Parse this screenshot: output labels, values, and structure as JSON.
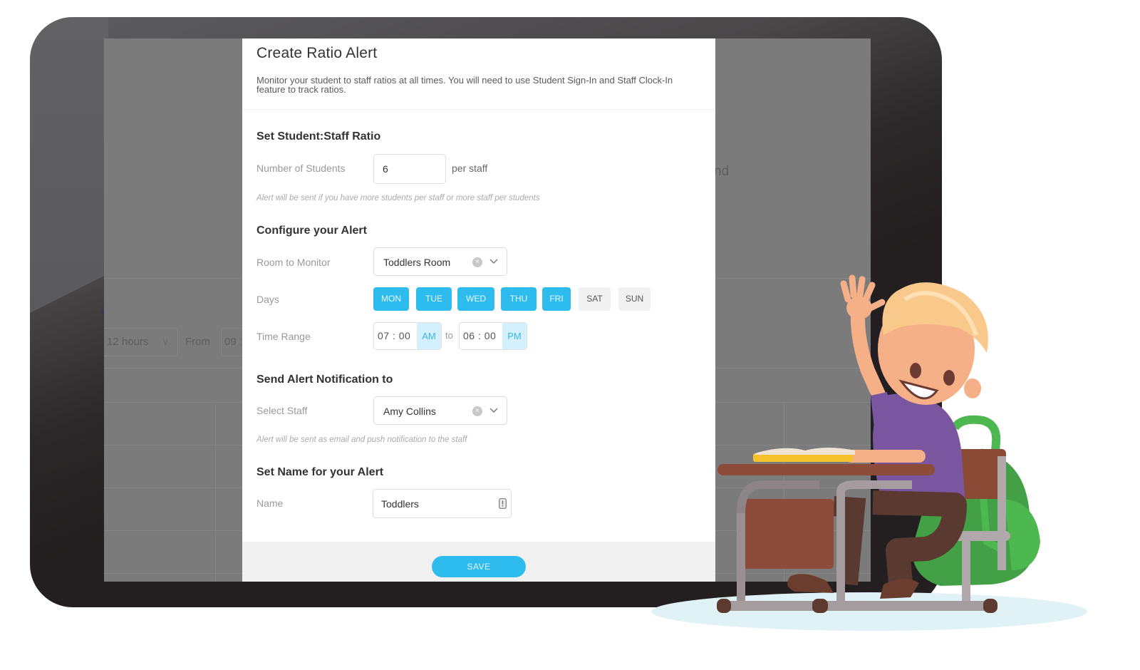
{
  "background_screen": {
    "duration_select": "12 hours",
    "from_label": "From",
    "from_time_partial": "09 :",
    "partial_text": "nd"
  },
  "modal": {
    "title": "Create Ratio Alert",
    "description": "Monitor your student to staff ratios at all times. You will need to use Student Sign-In and Staff Clock-In feature to track ratios.",
    "close_icon": "close-icon",
    "ratio_section": {
      "title": "Set Student:Staff Ratio",
      "students_label": "Number of Students",
      "students_value": "6",
      "suffix": "per staff",
      "hint": "Alert will be sent if you have more students per staff or more staff per students"
    },
    "configure_section": {
      "title": "Configure your Alert",
      "room_label": "Room to Monitor",
      "room_value": "Toddlers Room",
      "days_label": "Days",
      "days": [
        {
          "label": "MON",
          "selected": true
        },
        {
          "label": "TUE",
          "selected": true
        },
        {
          "label": "WED",
          "selected": true
        },
        {
          "label": "THU",
          "selected": true
        },
        {
          "label": "FRI",
          "selected": true
        },
        {
          "label": "SAT",
          "selected": false
        },
        {
          "label": "SUN",
          "selected": false
        }
      ],
      "time_range_label": "Time Range",
      "start_time": "07 : 00",
      "start_ampm": "AM",
      "to_label": "to",
      "end_time": "06 : 00",
      "end_ampm": "PM"
    },
    "notify_section": {
      "title": "Send Alert Notification to",
      "staff_label": "Select Staff",
      "staff_value": "Amy Collins",
      "hint": "Alert will be sent as email and push notification to the staff"
    },
    "name_section": {
      "title": "Set Name for your Alert",
      "name_label": "Name",
      "name_value": "Toddlers"
    },
    "save_label": "SAVE"
  },
  "colors": {
    "accent": "#2ebcee",
    "accent_light": "#d4f0fc",
    "overlay": "#7b7b7b",
    "tablet_frame": "#231f20"
  }
}
